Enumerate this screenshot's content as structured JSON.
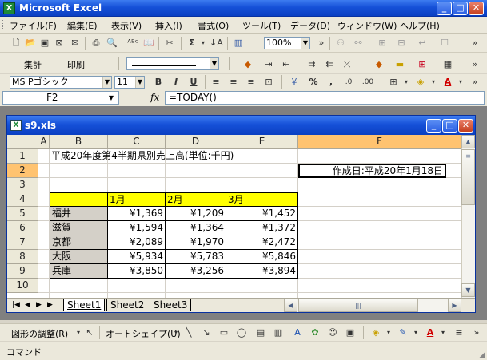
{
  "app": {
    "title": "Microsoft Excel"
  },
  "menus": [
    "ファイル(F)",
    "編集(E)",
    "表示(V)",
    "挿入(I)",
    "書式(O)",
    "ツール(T)",
    "データ(D)",
    "ウィンドウ(W)",
    "ヘルプ(H)"
  ],
  "toolbar_standard": {
    "zoom": "100%"
  },
  "toolbar_custom": {
    "calc_label": "集計",
    "print_label": "印刷"
  },
  "toolbar_format": {
    "font": "MS Pゴシック",
    "size": "11"
  },
  "formula_bar": {
    "name_box": "F2",
    "fx": "fx",
    "formula": "=TODAY()"
  },
  "workbook": {
    "title": "s9.xls"
  },
  "columns": [
    "A",
    "B",
    "C",
    "D",
    "E",
    "F"
  ],
  "rows": [
    "1",
    "2",
    "3",
    "4",
    "5",
    "6",
    "7",
    "8",
    "9",
    "10"
  ],
  "cells": {
    "b1": "平成20年度第4半期県別売上高(単位:千円)",
    "f2": "作成日:平成20年1月18日",
    "c4": "1月",
    "d4": "2月",
    "e4": "3月",
    "b5": "福井",
    "c5": "¥1,369",
    "d5": "¥1,209",
    "e5": "¥1,452",
    "b6": "滋賀",
    "c6": "¥1,594",
    "d6": "¥1,364",
    "e6": "¥1,372",
    "b7": "京都",
    "c7": "¥2,089",
    "d7": "¥1,970",
    "e7": "¥2,472",
    "b8": "大阪",
    "c8": "¥5,934",
    "d8": "¥5,783",
    "e8": "¥5,846",
    "b9": "兵庫",
    "c9": "¥3,850",
    "d9": "¥3,256",
    "e9": "¥3,894"
  },
  "sheets": [
    "Sheet1",
    "Sheet2",
    "Sheet3"
  ],
  "drawing": {
    "adjust_label": "図形の調整(R)",
    "autoshape_label": "オートシェイプ(U)"
  },
  "status": {
    "mode": "コマンド"
  },
  "colors": {
    "title_blue": "#1651d8",
    "header_yellow": "#ffff00",
    "selected_header": "#ffc370"
  }
}
